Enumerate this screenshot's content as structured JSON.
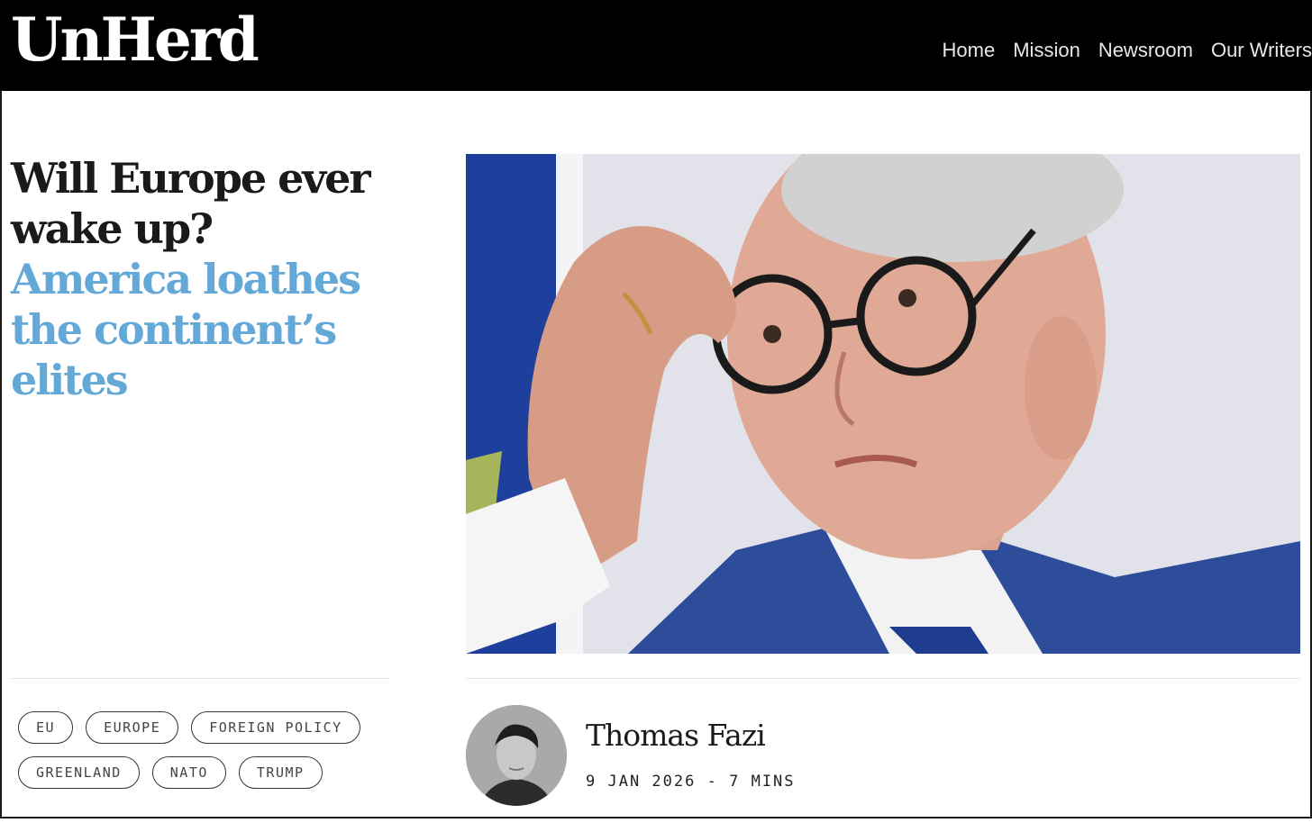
{
  "site": {
    "logo": "UnHerd"
  },
  "nav": {
    "items": [
      {
        "label": "Home"
      },
      {
        "label": "Mission"
      },
      {
        "label": "Newsroom"
      },
      {
        "label": "Our Writers"
      }
    ]
  },
  "article": {
    "headline": "Will Europe ever wake up?",
    "subheadline": "America loathes the continent’s elites",
    "author": "Thomas Fazi",
    "date": "9 JAN 2026",
    "separator": "-",
    "read_time": "7 MINS",
    "hero_image": "photo of a man in glasses and a blue suit rubbing his forehead",
    "tags": [
      {
        "label": "EU"
      },
      {
        "label": "EUROPE"
      },
      {
        "label": "FOREIGN POLICY"
      },
      {
        "label": "GREENLAND"
      },
      {
        "label": "NATO"
      },
      {
        "label": "TRUMP"
      }
    ]
  },
  "colors": {
    "topbar": "#000000",
    "accent_blue": "#64a8d8",
    "text": "#1a1a1a"
  }
}
